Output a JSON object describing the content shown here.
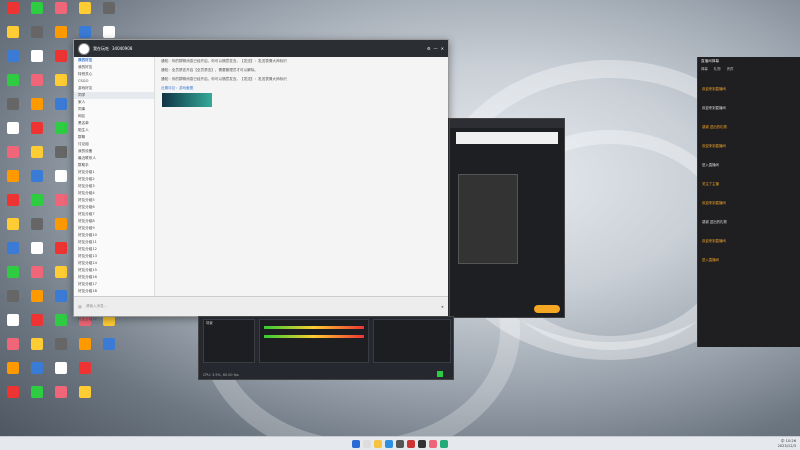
{
  "qq": {
    "title": "我在玩吃",
    "uid": "34040908",
    "group_header": "我的好友",
    "sidebar_items": [
      "我的好友",
      "特别关心",
      "CSGO",
      "游戏好友",
      "同学",
      "家人",
      "同事",
      "网友",
      "黑名单",
      "陌生人",
      "群聊",
      "讨论组",
      "我的设备",
      "最近联系人",
      "群助手",
      "好友分组1",
      "好友分组2",
      "好友分组3",
      "好友分组4",
      "好友分组5",
      "好友分组6",
      "好友分组7",
      "好友分组8",
      "好友分组9",
      "好友分组10",
      "好友分组11",
      "好友分组12",
      "好友分组13",
      "好友分组14",
      "好友分组15",
      "好友分组16",
      "好友分组17",
      "好友分组18",
      "好友分组19",
      "好友分组20",
      "好友分组21",
      "好友分组22"
    ],
    "messages": [
      "通知：你的群聊消息已经开启，你可以随意发言。【发送】：发送表情大师标识",
      "通知：全员禁言开启【全员禁言】，需要管理员才可以解除。",
      "通知：你的群聊消息已经开启，你可以随意发言。【发送】：发送表情大师标识",
      "近期评论：游戏截图"
    ],
    "input_placeholder": "请输入消息..."
  },
  "live": {
    "header": "直播间弹幕",
    "tabs": [
      "弹幕",
      "礼物",
      "贵宾"
    ],
    "lines": [
      "欢迎来到直播间",
      "欢迎来到直播间",
      "感谢 送出的礼物",
      "欢迎来到直播间",
      "进入直播间",
      "关注了主播",
      "欢迎来到直播间",
      "感谢 送出的礼物",
      "欢迎来到直播间",
      "进入直播间"
    ]
  },
  "obs": {
    "stats": "CPU: 3.9%, 60.00 fps",
    "time": "00:00:00"
  },
  "colors": {
    "accent": "#f5a623",
    "qq_top": "#2b2f33"
  }
}
